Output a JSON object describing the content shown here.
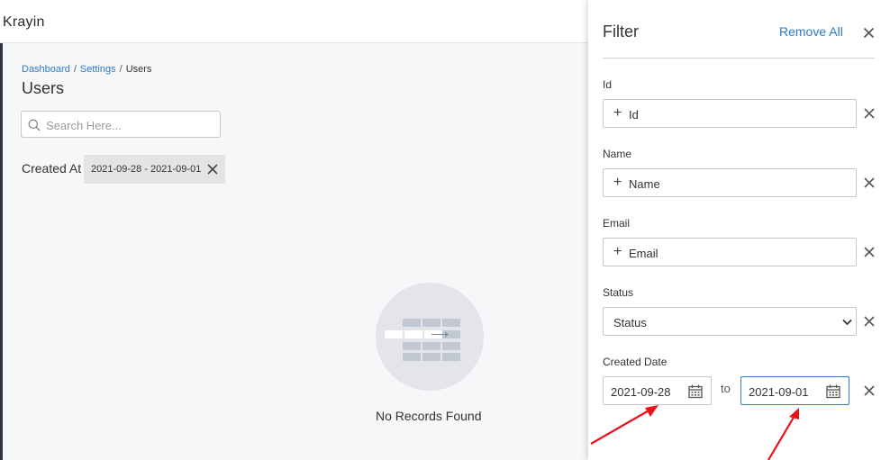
{
  "header": {
    "brand": "Krayin"
  },
  "breadcrumb": {
    "items": [
      "Dashboard",
      "Settings",
      "Users"
    ],
    "separator": "/"
  },
  "page": {
    "title": "Users"
  },
  "search": {
    "placeholder": "Search Here..."
  },
  "applied_filters": {
    "label": "Created At",
    "chips": [
      {
        "value": "2021-09-28 - 2021-09-01"
      }
    ]
  },
  "empty_state": {
    "message": "No Records Found"
  },
  "filter_panel": {
    "title": "Filter",
    "remove_all_label": "Remove All",
    "fields": [
      {
        "label": "Id",
        "button_text": "Id"
      },
      {
        "label": "Name",
        "button_text": "Name"
      },
      {
        "label": "Email",
        "button_text": "Email"
      }
    ],
    "status": {
      "label": "Status",
      "selected": "Status"
    },
    "created_date": {
      "label": "Created Date",
      "from": "2021-09-28",
      "separator": "to",
      "to": "2021-09-01"
    }
  },
  "colors": {
    "accent": "#2f7ac0",
    "annotation_arrow": "#e8141b",
    "main_bg": "#f6f7f9",
    "sidebar": "#2c3440"
  }
}
